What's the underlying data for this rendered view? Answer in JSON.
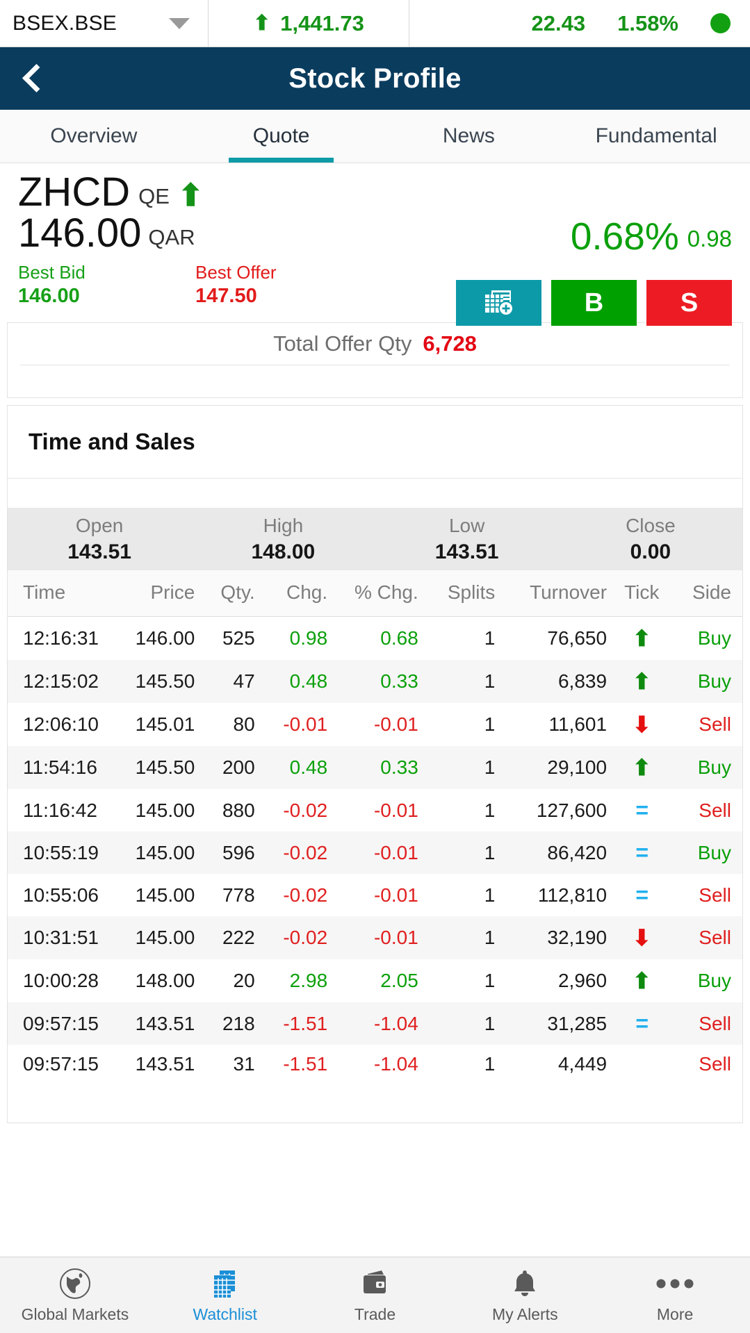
{
  "ticker_bar": {
    "symbol": "BSEX.BSE",
    "index_value": "1,441.73",
    "index_direction": "up",
    "change": "22.43",
    "change_pct": "1.58%",
    "status_color": "#12a012",
    "positive_color": "#159318"
  },
  "header": {
    "title": "Stock Profile",
    "back_icon": "chevron-left-icon"
  },
  "tabs": [
    {
      "label": "Overview",
      "active": false
    },
    {
      "label": "Quote",
      "active": true
    },
    {
      "label": "News",
      "active": false
    },
    {
      "label": "Fundamental",
      "active": false
    }
  ],
  "accent_color": "#0e9aa7",
  "stock": {
    "symbol": "ZHCD",
    "exchange": "QE",
    "direction": "up",
    "price": "146.00",
    "currency": "QAR",
    "change_pct": "0.68%",
    "change_abs": "0.98",
    "best_bid_label": "Best Bid",
    "best_bid": "146.00",
    "best_offer_label": "Best Offer",
    "best_offer": "147.50",
    "up_color": "#159318",
    "down_color": "#e21b1b"
  },
  "actions": [
    {
      "name": "add-to-watchlist",
      "label": "",
      "icon": "add-watchlist-icon",
      "color": "#0d9aa8"
    },
    {
      "name": "buy",
      "label": "B",
      "icon": "",
      "color": "#00a000"
    },
    {
      "name": "sell",
      "label": "S",
      "icon": "",
      "color": "#ed1c24"
    }
  ],
  "total_offer": {
    "label": "Total Offer Qty",
    "value": "6,728",
    "value_color": "#e30613"
  },
  "time_and_sales": {
    "title": "Time and Sales",
    "ohlc": [
      {
        "label": "Open",
        "value": "143.51"
      },
      {
        "label": "High",
        "value": "148.00"
      },
      {
        "label": "Low",
        "value": "143.51"
      },
      {
        "label": "Close",
        "value": "0.00"
      }
    ],
    "columns": [
      "Time",
      "Price",
      "Qty.",
      "Chg.",
      "% Chg.",
      "Splits",
      "Turnover",
      "Tick",
      "Side"
    ],
    "rows": [
      {
        "time": "12:16:31",
        "price": "146.00",
        "qty": "525",
        "chg": "0.98",
        "chg_sign": "pos",
        "pchg": "0.68",
        "pchg_sign": "pos",
        "splits": "1",
        "turnover": "76,650",
        "tick": "up",
        "side": "Buy"
      },
      {
        "time": "12:15:02",
        "price": "145.50",
        "qty": "47",
        "chg": "0.48",
        "chg_sign": "pos",
        "pchg": "0.33",
        "pchg_sign": "pos",
        "splits": "1",
        "turnover": "6,839",
        "tick": "up",
        "side": "Buy"
      },
      {
        "time": "12:06:10",
        "price": "145.01",
        "qty": "80",
        "chg": "-0.01",
        "chg_sign": "neg",
        "pchg": "-0.01",
        "pchg_sign": "neg",
        "splits": "1",
        "turnover": "11,601",
        "tick": "down",
        "side": "Sell"
      },
      {
        "time": "11:54:16",
        "price": "145.50",
        "qty": "200",
        "chg": "0.48",
        "chg_sign": "pos",
        "pchg": "0.33",
        "pchg_sign": "pos",
        "splits": "1",
        "turnover": "29,100",
        "tick": "up",
        "side": "Buy"
      },
      {
        "time": "11:16:42",
        "price": "145.00",
        "qty": "880",
        "chg": "-0.02",
        "chg_sign": "neg",
        "pchg": "-0.01",
        "pchg_sign": "neg",
        "splits": "1",
        "turnover": "127,600",
        "tick": "equal",
        "side": "Sell"
      },
      {
        "time": "10:55:19",
        "price": "145.00",
        "qty": "596",
        "chg": "-0.02",
        "chg_sign": "neg",
        "pchg": "-0.01",
        "pchg_sign": "neg",
        "splits": "1",
        "turnover": "86,420",
        "tick": "equal",
        "side": "Buy"
      },
      {
        "time": "10:55:06",
        "price": "145.00",
        "qty": "778",
        "chg": "-0.02",
        "chg_sign": "neg",
        "pchg": "-0.01",
        "pchg_sign": "neg",
        "splits": "1",
        "turnover": "112,810",
        "tick": "equal",
        "side": "Sell"
      },
      {
        "time": "10:31:51",
        "price": "145.00",
        "qty": "222",
        "chg": "-0.02",
        "chg_sign": "neg",
        "pchg": "-0.01",
        "pchg_sign": "neg",
        "splits": "1",
        "turnover": "32,190",
        "tick": "down",
        "side": "Sell"
      },
      {
        "time": "10:00:28",
        "price": "148.00",
        "qty": "20",
        "chg": "2.98",
        "chg_sign": "pos",
        "pchg": "2.05",
        "pchg_sign": "pos",
        "splits": "1",
        "turnover": "2,960",
        "tick": "up",
        "side": "Buy"
      },
      {
        "time": "09:57:15",
        "price": "143.51",
        "qty": "218",
        "chg": "-1.51",
        "chg_sign": "neg",
        "pchg": "-1.04",
        "pchg_sign": "neg",
        "splits": "1",
        "turnover": "31,285",
        "tick": "equal",
        "side": "Sell"
      },
      {
        "time": "09:57:15",
        "price": "143.51",
        "qty": "31",
        "chg": "-1.51",
        "chg_sign": "neg",
        "pchg": "-1.04",
        "pchg_sign": "neg",
        "splits": "1",
        "turnover": "4,449",
        "tick": "none",
        "side": "Sell"
      }
    ]
  },
  "bottom_nav": [
    {
      "label": "Global Markets",
      "icon": "globe-icon",
      "active": false
    },
    {
      "label": "Watchlist",
      "icon": "grid-watchlist-icon",
      "active": true
    },
    {
      "label": "Trade",
      "icon": "wallet-icon",
      "active": false
    },
    {
      "label": "My Alerts",
      "icon": "bell-icon",
      "active": false
    },
    {
      "label": "More",
      "icon": "ellipsis-icon",
      "active": false
    }
  ],
  "nav_active_color": "#1b8fd6"
}
